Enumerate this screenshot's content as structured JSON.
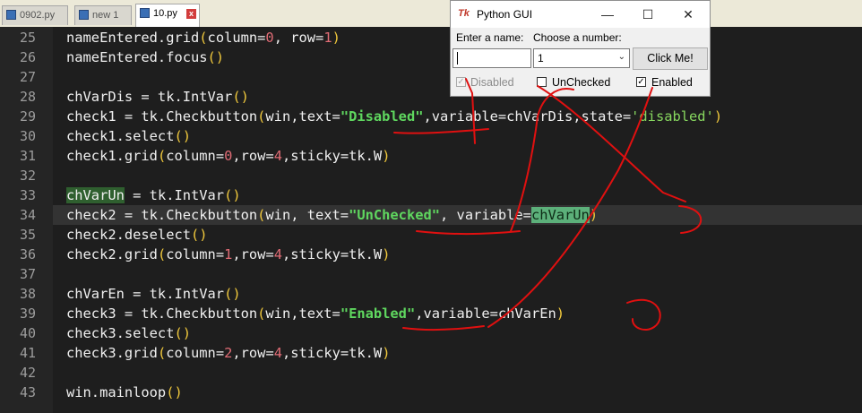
{
  "editor": {
    "tabs": [
      {
        "label": "0902.py",
        "active": false
      },
      {
        "label": "new 1",
        "active": false
      },
      {
        "label": "10.py",
        "active": true
      }
    ],
    "lines": [
      {
        "n": "25"
      },
      {
        "n": "26"
      },
      {
        "n": "27"
      },
      {
        "n": "28"
      },
      {
        "n": "29"
      },
      {
        "n": "30"
      },
      {
        "n": "31"
      },
      {
        "n": "32"
      },
      {
        "n": "33"
      },
      {
        "n": "34"
      },
      {
        "n": "35"
      },
      {
        "n": "36"
      },
      {
        "n": "37"
      },
      {
        "n": "38"
      },
      {
        "n": "39"
      },
      {
        "n": "40"
      },
      {
        "n": "41"
      },
      {
        "n": "42"
      },
      {
        "n": "43"
      }
    ],
    "code": {
      "l25": {
        "a": "nameEntered.grid",
        "b": "(",
        "c": "column=",
        "d": "0",
        "e": ", row=",
        "f": "1",
        "g": ")"
      },
      "l26": {
        "a": "nameEntered.focus",
        "b": "()"
      },
      "l28": {
        "a": "chVarDis = tk.IntVar",
        "b": "()"
      },
      "l29": {
        "a": "check1 = tk.Checkbutton",
        "b": "(",
        "c": "win,text=",
        "d": "\"Disabled\"",
        "e": ",variable=chVarDis,state=",
        "f": "'disabled'",
        "g": ")"
      },
      "l30": {
        "a": "check1.select",
        "b": "()"
      },
      "l31": {
        "a": "check1.grid",
        "b": "(",
        "c": "column=",
        "d": "0",
        "e": ",row=",
        "f": "4",
        "g": ",sticky=tk.W",
        "h": ")"
      },
      "l33": {
        "a": "chVarUn",
        "b": " = tk.IntVar",
        "c": "()"
      },
      "l34": {
        "a": "check2 = tk.Checkbutton",
        "b": "(",
        "c": "win, text=",
        "d": "\"UnChecked\"",
        "e": ", variable=",
        "f": "chVarUn",
        "g": ")"
      },
      "l35": {
        "a": "check2.deselect",
        "b": "()"
      },
      "l36": {
        "a": "check2.grid",
        "b": "(",
        "c": "column=",
        "d": "1",
        "e": ",row=",
        "f": "4",
        "g": ",sticky=tk.W",
        "h": ")"
      },
      "l38": {
        "a": "chVarEn = tk.IntVar",
        "b": "()"
      },
      "l39": {
        "a": "check3 = tk.Checkbutton",
        "b": "(",
        "c": "win,text=",
        "d": "\"Enabled\"",
        "e": ",variable=chVarEn",
        "f": ")"
      },
      "l40": {
        "a": "check3.select",
        "b": "()"
      },
      "l41": {
        "a": "check3.grid",
        "b": "(",
        "c": "column=",
        "d": "2",
        "e": ",row=",
        "f": "4",
        "g": ",sticky=tk.W",
        "h": ")"
      },
      "l43": {
        "a": "win.mainloop",
        "b": "()"
      }
    }
  },
  "dialog": {
    "title": "Python GUI",
    "title_icon": "Tk",
    "minimize": "—",
    "maximize": "☐",
    "close": "✕",
    "name_label": "Enter a name:",
    "number_label": "Choose a number:",
    "name_value": "",
    "number_value": "1",
    "button_label": "Click Me!",
    "check1": {
      "label": "Disabled",
      "checked": true,
      "disabled": true
    },
    "check2": {
      "label": "UnChecked",
      "checked": false,
      "disabled": false
    },
    "check3": {
      "label": "Enabled",
      "checked": true,
      "disabled": false
    }
  },
  "colors": {
    "background": "#1e1e1e",
    "numbers": "#e06c75",
    "strings": "#5fd75f",
    "parens": "#f0c83c",
    "annotation_ink": "#e01010"
  }
}
